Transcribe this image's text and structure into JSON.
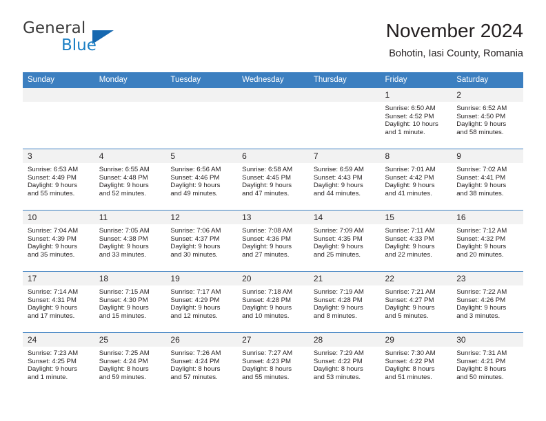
{
  "brand": {
    "name_part1": "General",
    "name_part2": "Blue",
    "logo_icon": "triangle-logo-icon"
  },
  "header": {
    "month_title": "November 2024",
    "location": "Bohotin, Iasi County, Romania"
  },
  "colors": {
    "header_blue": "#3c7fc0",
    "logo_blue": "#1b7fc4",
    "daynum_band": "#f2f2f2",
    "text": "#231f20"
  },
  "calendar": {
    "weekday_headers": [
      "Sunday",
      "Monday",
      "Tuesday",
      "Wednesday",
      "Thursday",
      "Friday",
      "Saturday"
    ],
    "weeks": [
      [
        {
          "day": "",
          "blank": true,
          "sunrise": "",
          "sunset": "",
          "daylight1": "",
          "daylight2": ""
        },
        {
          "day": "",
          "blank": true,
          "sunrise": "",
          "sunset": "",
          "daylight1": "",
          "daylight2": ""
        },
        {
          "day": "",
          "blank": true,
          "sunrise": "",
          "sunset": "",
          "daylight1": "",
          "daylight2": ""
        },
        {
          "day": "",
          "blank": true,
          "sunrise": "",
          "sunset": "",
          "daylight1": "",
          "daylight2": ""
        },
        {
          "day": "",
          "blank": true,
          "sunrise": "",
          "sunset": "",
          "daylight1": "",
          "daylight2": ""
        },
        {
          "day": "1",
          "blank": false,
          "sunrise": "Sunrise: 6:50 AM",
          "sunset": "Sunset: 4:52 PM",
          "daylight1": "Daylight: 10 hours",
          "daylight2": "and 1 minute."
        },
        {
          "day": "2",
          "blank": false,
          "sunrise": "Sunrise: 6:52 AM",
          "sunset": "Sunset: 4:50 PM",
          "daylight1": "Daylight: 9 hours",
          "daylight2": "and 58 minutes."
        }
      ],
      [
        {
          "day": "3",
          "blank": false,
          "sunrise": "Sunrise: 6:53 AM",
          "sunset": "Sunset: 4:49 PM",
          "daylight1": "Daylight: 9 hours",
          "daylight2": "and 55 minutes."
        },
        {
          "day": "4",
          "blank": false,
          "sunrise": "Sunrise: 6:55 AM",
          "sunset": "Sunset: 4:48 PM",
          "daylight1": "Daylight: 9 hours",
          "daylight2": "and 52 minutes."
        },
        {
          "day": "5",
          "blank": false,
          "sunrise": "Sunrise: 6:56 AM",
          "sunset": "Sunset: 4:46 PM",
          "daylight1": "Daylight: 9 hours",
          "daylight2": "and 49 minutes."
        },
        {
          "day": "6",
          "blank": false,
          "sunrise": "Sunrise: 6:58 AM",
          "sunset": "Sunset: 4:45 PM",
          "daylight1": "Daylight: 9 hours",
          "daylight2": "and 47 minutes."
        },
        {
          "day": "7",
          "blank": false,
          "sunrise": "Sunrise: 6:59 AM",
          "sunset": "Sunset: 4:43 PM",
          "daylight1": "Daylight: 9 hours",
          "daylight2": "and 44 minutes."
        },
        {
          "day": "8",
          "blank": false,
          "sunrise": "Sunrise: 7:01 AM",
          "sunset": "Sunset: 4:42 PM",
          "daylight1": "Daylight: 9 hours",
          "daylight2": "and 41 minutes."
        },
        {
          "day": "9",
          "blank": false,
          "sunrise": "Sunrise: 7:02 AM",
          "sunset": "Sunset: 4:41 PM",
          "daylight1": "Daylight: 9 hours",
          "daylight2": "and 38 minutes."
        }
      ],
      [
        {
          "day": "10",
          "blank": false,
          "sunrise": "Sunrise: 7:04 AM",
          "sunset": "Sunset: 4:39 PM",
          "daylight1": "Daylight: 9 hours",
          "daylight2": "and 35 minutes."
        },
        {
          "day": "11",
          "blank": false,
          "sunrise": "Sunrise: 7:05 AM",
          "sunset": "Sunset: 4:38 PM",
          "daylight1": "Daylight: 9 hours",
          "daylight2": "and 33 minutes."
        },
        {
          "day": "12",
          "blank": false,
          "sunrise": "Sunrise: 7:06 AM",
          "sunset": "Sunset: 4:37 PM",
          "daylight1": "Daylight: 9 hours",
          "daylight2": "and 30 minutes."
        },
        {
          "day": "13",
          "blank": false,
          "sunrise": "Sunrise: 7:08 AM",
          "sunset": "Sunset: 4:36 PM",
          "daylight1": "Daylight: 9 hours",
          "daylight2": "and 27 minutes."
        },
        {
          "day": "14",
          "blank": false,
          "sunrise": "Sunrise: 7:09 AM",
          "sunset": "Sunset: 4:35 PM",
          "daylight1": "Daylight: 9 hours",
          "daylight2": "and 25 minutes."
        },
        {
          "day": "15",
          "blank": false,
          "sunrise": "Sunrise: 7:11 AM",
          "sunset": "Sunset: 4:33 PM",
          "daylight1": "Daylight: 9 hours",
          "daylight2": "and 22 minutes."
        },
        {
          "day": "16",
          "blank": false,
          "sunrise": "Sunrise: 7:12 AM",
          "sunset": "Sunset: 4:32 PM",
          "daylight1": "Daylight: 9 hours",
          "daylight2": "and 20 minutes."
        }
      ],
      [
        {
          "day": "17",
          "blank": false,
          "sunrise": "Sunrise: 7:14 AM",
          "sunset": "Sunset: 4:31 PM",
          "daylight1": "Daylight: 9 hours",
          "daylight2": "and 17 minutes."
        },
        {
          "day": "18",
          "blank": false,
          "sunrise": "Sunrise: 7:15 AM",
          "sunset": "Sunset: 4:30 PM",
          "daylight1": "Daylight: 9 hours",
          "daylight2": "and 15 minutes."
        },
        {
          "day": "19",
          "blank": false,
          "sunrise": "Sunrise: 7:17 AM",
          "sunset": "Sunset: 4:29 PM",
          "daylight1": "Daylight: 9 hours",
          "daylight2": "and 12 minutes."
        },
        {
          "day": "20",
          "blank": false,
          "sunrise": "Sunrise: 7:18 AM",
          "sunset": "Sunset: 4:28 PM",
          "daylight1": "Daylight: 9 hours",
          "daylight2": "and 10 minutes."
        },
        {
          "day": "21",
          "blank": false,
          "sunrise": "Sunrise: 7:19 AM",
          "sunset": "Sunset: 4:28 PM",
          "daylight1": "Daylight: 9 hours",
          "daylight2": "and 8 minutes."
        },
        {
          "day": "22",
          "blank": false,
          "sunrise": "Sunrise: 7:21 AM",
          "sunset": "Sunset: 4:27 PM",
          "daylight1": "Daylight: 9 hours",
          "daylight2": "and 5 minutes."
        },
        {
          "day": "23",
          "blank": false,
          "sunrise": "Sunrise: 7:22 AM",
          "sunset": "Sunset: 4:26 PM",
          "daylight1": "Daylight: 9 hours",
          "daylight2": "and 3 minutes."
        }
      ],
      [
        {
          "day": "24",
          "blank": false,
          "sunrise": "Sunrise: 7:23 AM",
          "sunset": "Sunset: 4:25 PM",
          "daylight1": "Daylight: 9 hours",
          "daylight2": "and 1 minute."
        },
        {
          "day": "25",
          "blank": false,
          "sunrise": "Sunrise: 7:25 AM",
          "sunset": "Sunset: 4:24 PM",
          "daylight1": "Daylight: 8 hours",
          "daylight2": "and 59 minutes."
        },
        {
          "day": "26",
          "blank": false,
          "sunrise": "Sunrise: 7:26 AM",
          "sunset": "Sunset: 4:24 PM",
          "daylight1": "Daylight: 8 hours",
          "daylight2": "and 57 minutes."
        },
        {
          "day": "27",
          "blank": false,
          "sunrise": "Sunrise: 7:27 AM",
          "sunset": "Sunset: 4:23 PM",
          "daylight1": "Daylight: 8 hours",
          "daylight2": "and 55 minutes."
        },
        {
          "day": "28",
          "blank": false,
          "sunrise": "Sunrise: 7:29 AM",
          "sunset": "Sunset: 4:22 PM",
          "daylight1": "Daylight: 8 hours",
          "daylight2": "and 53 minutes."
        },
        {
          "day": "29",
          "blank": false,
          "sunrise": "Sunrise: 7:30 AM",
          "sunset": "Sunset: 4:22 PM",
          "daylight1": "Daylight: 8 hours",
          "daylight2": "and 51 minutes."
        },
        {
          "day": "30",
          "blank": false,
          "sunrise": "Sunrise: 7:31 AM",
          "sunset": "Sunset: 4:21 PM",
          "daylight1": "Daylight: 8 hours",
          "daylight2": "and 50 minutes."
        }
      ]
    ]
  }
}
